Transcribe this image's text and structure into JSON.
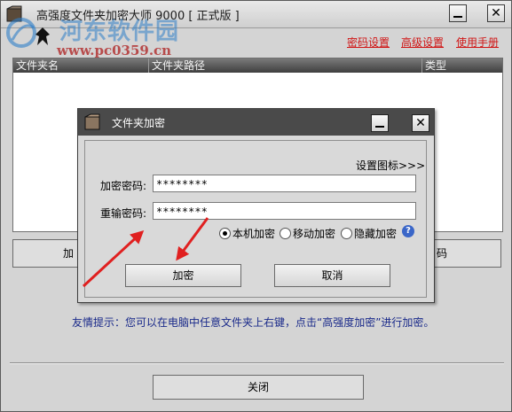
{
  "window": {
    "title": "高强度文件夹加密大师 9000 [ 正式版 ]",
    "close_label": "关闭"
  },
  "watermark": {
    "line1": "河东软件园",
    "line2": "www.pc0359.cn"
  },
  "top_links": [
    {
      "label": "密码设置"
    },
    {
      "label": "高级设置"
    },
    {
      "label": "使用手册"
    }
  ],
  "list": {
    "columns": [
      "文件夹名",
      "文件夹路径",
      "类型"
    ],
    "rows": []
  },
  "main_buttons": {
    "left_partial": "加",
    "right_partial": "码"
  },
  "tip": "友情提示：您可以在电脑中任意文件夹上右键，点击“高强度加密”进行加密。",
  "dialog": {
    "title": "文件夹加密",
    "settings_link": "设置图标>>>",
    "password_label": "加密密码:",
    "password_value": "********",
    "confirm_label": "重输密码:",
    "confirm_value": "********",
    "radios": [
      {
        "label": "本机加密",
        "checked": true
      },
      {
        "label": "移动加密",
        "checked": false
      },
      {
        "label": "隐藏加密",
        "checked": false
      }
    ],
    "help_glyph": "?",
    "ok_label": "加密",
    "cancel_label": "取消"
  },
  "colors": {
    "link_red": "#d01515",
    "tip_blue": "#1a2a8a",
    "arrow_red": "#e02020",
    "dialog_title_bg": "#4a4a4a"
  },
  "icons": [
    "app-folder-icon",
    "minimize-icon",
    "close-icon",
    "help-icon",
    "watermark-logo-icon"
  ]
}
